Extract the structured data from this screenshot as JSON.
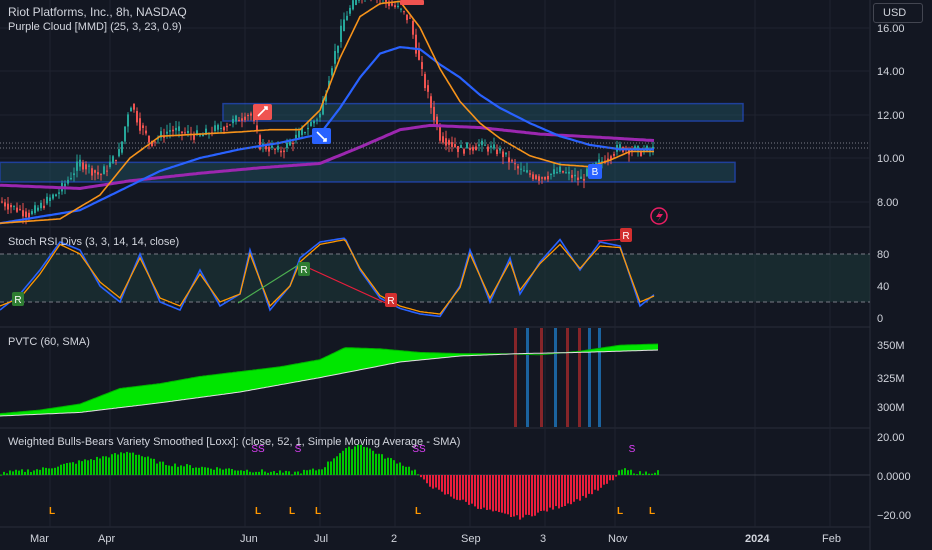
{
  "header": {
    "symbol_line": "Riot Platforms, Inc., 8h, NASDAQ",
    "indicator_line": "Purple Cloud [MMD] (25, 3, 23, 0.9)"
  },
  "currency_button": "USD",
  "panes": {
    "stoch_title": "Stoch RSI Divs (3, 3, 14, 14, close)",
    "pvtc_title": "PVTC  (60, SMA)",
    "loxx_title": "Weighted Bulls-Bears Variety Smoothed [Loxx]: (close, 52, 1, Simple Moving Average - SMA)"
  },
  "price_axis_labels": [
    "16.00",
    "14.00",
    "12.00",
    "10.00",
    "8.00"
  ],
  "stoch_axis_labels": [
    "80",
    "40",
    "0"
  ],
  "pvtc_axis_labels": [
    "350M",
    "325M",
    "300M"
  ],
  "loxx_axis_labels": [
    "20.00",
    "0.0000",
    "−20.00"
  ],
  "time_axis_labels": [
    "Mar",
    "Apr",
    "Jun",
    "Jul",
    "2",
    "Sep",
    "3",
    "Nov",
    "2024",
    "Feb"
  ],
  "markers": {
    "r_label": "R",
    "b_label": "B",
    "s_label": "S",
    "ss_label": "SS",
    "l_label": "L"
  },
  "colors": {
    "background": "#131722",
    "bull_candle": "#26a69a",
    "bear_candle": "#ef5350",
    "ma_blue": "#2962ff",
    "ma_orange": "#f7931a",
    "ma_purple": "#9c27b0",
    "stoch_k": "#2962ff",
    "stoch_d": "#ff9800",
    "pvtc_fill": "#00e600",
    "hist_pos": "#00c800",
    "hist_neg": "#e91e3c",
    "zone_border": "#2962ff"
  },
  "chart_data": [
    {
      "type": "candlestick",
      "title": "Riot Platforms, Inc., 8h, NASDAQ",
      "y_axis_labels": [
        "16.00",
        "14.00",
        "12.00",
        "10.00",
        "8.00"
      ],
      "x_axis_labels": [
        "Mar",
        "Apr",
        "Jun",
        "Jul",
        "2",
        "Sep",
        "3",
        "Nov",
        "2024",
        "Feb"
      ],
      "ylim": [
        7.0,
        17.0
      ],
      "close_path": [
        [
          0,
          8.0
        ],
        [
          30,
          7.4
        ],
        [
          60,
          8.5
        ],
        [
          80,
          9.8
        ],
        [
          100,
          9.2
        ],
        [
          120,
          10.3
        ],
        [
          130,
          12.6
        ],
        [
          140,
          11.5
        ],
        [
          150,
          10.7
        ],
        [
          170,
          11.3
        ],
        [
          200,
          11.0
        ],
        [
          230,
          11.6
        ],
        [
          250,
          12.1
        ],
        [
          260,
          10.6
        ],
        [
          280,
          10.3
        ],
        [
          300,
          11.1
        ],
        [
          320,
          12.0
        ],
        [
          330,
          14.0
        ],
        [
          345,
          16.5
        ],
        [
          360,
          17.5
        ],
        [
          375,
          17.5
        ],
        [
          400,
          16.8
        ],
        [
          410,
          16.3
        ],
        [
          420,
          14.2
        ],
        [
          430,
          12.5
        ],
        [
          440,
          11.0
        ],
        [
          460,
          10.4
        ],
        [
          480,
          10.6
        ],
        [
          500,
          10.3
        ],
        [
          520,
          9.4
        ],
        [
          540,
          9.1
        ],
        [
          560,
          9.4
        ],
        [
          580,
          9.0
        ],
        [
          600,
          9.8
        ],
        [
          620,
          10.5
        ],
        [
          640,
          10.3
        ],
        [
          655,
          10.4
        ]
      ],
      "ma_orange": [
        [
          0,
          7.0
        ],
        [
          60,
          7.2
        ],
        [
          100,
          8.3
        ],
        [
          130,
          10.0
        ],
        [
          160,
          11.0
        ],
        [
          200,
          11.1
        ],
        [
          240,
          11.2
        ],
        [
          270,
          11.3
        ],
        [
          300,
          11.3
        ],
        [
          320,
          12.2
        ],
        [
          340,
          14.6
        ],
        [
          360,
          16.5
        ],
        [
          380,
          17.1
        ],
        [
          400,
          17.2
        ],
        [
          420,
          16.0
        ],
        [
          440,
          14.1
        ],
        [
          460,
          12.6
        ],
        [
          480,
          11.6
        ],
        [
          500,
          10.9
        ],
        [
          530,
          10.1
        ],
        [
          560,
          9.7
        ],
        [
          590,
          9.6
        ],
        [
          610,
          9.9
        ],
        [
          630,
          10.3
        ],
        [
          655,
          10.3
        ]
      ],
      "ma_blue": [
        [
          0,
          7.0
        ],
        [
          80,
          7.6
        ],
        [
          120,
          8.5
        ],
        [
          160,
          9.4
        ],
        [
          200,
          10.0
        ],
        [
          240,
          10.4
        ],
        [
          280,
          10.7
        ],
        [
          320,
          11.1
        ],
        [
          340,
          12.3
        ],
        [
          360,
          13.7
        ],
        [
          380,
          14.8
        ],
        [
          400,
          15.1
        ],
        [
          420,
          15.0
        ],
        [
          440,
          14.3
        ],
        [
          460,
          13.7
        ],
        [
          480,
          12.9
        ],
        [
          500,
          12.3
        ],
        [
          530,
          11.6
        ],
        [
          560,
          11.0
        ],
        [
          590,
          10.6
        ],
        [
          620,
          10.4
        ],
        [
          655,
          10.4
        ]
      ],
      "ma_purple": [
        [
          0,
          8.75
        ],
        [
          80,
          8.6
        ],
        [
          130,
          8.95
        ],
        [
          200,
          9.3
        ],
        [
          260,
          9.55
        ],
        [
          320,
          9.75
        ],
        [
          360,
          10.5
        ],
        [
          400,
          11.3
        ],
        [
          430,
          11.5
        ],
        [
          480,
          11.4
        ],
        [
          540,
          11.1
        ],
        [
          600,
          10.95
        ],
        [
          655,
          10.8
        ]
      ],
      "zones": [
        {
          "low": 11.7,
          "high": 12.5
        },
        {
          "low": 8.9,
          "high": 9.8
        }
      ]
    },
    {
      "type": "line",
      "title": "Stoch RSI Divs (3, 3, 14, 14, close)",
      "y_axis_labels": [
        "80",
        "40",
        "0"
      ],
      "ylim": [
        0,
        100
      ],
      "bands": [
        20,
        80
      ],
      "series": [
        {
          "name": "K",
          "values": [
            [
              0,
              10
            ],
            [
              20,
              30
            ],
            [
              40,
              60
            ],
            [
              60,
              95
            ],
            [
              80,
              85
            ],
            [
              100,
              40
            ],
            [
              120,
              20
            ],
            [
              140,
              80
            ],
            [
              160,
              20
            ],
            [
              180,
              10
            ],
            [
              200,
              60
            ],
            [
              220,
              15
            ],
            [
              240,
              30
            ],
            [
              250,
              85
            ],
            [
              270,
              10
            ],
            [
              290,
              40
            ],
            [
              300,
              75
            ],
            [
              320,
              95
            ],
            [
              345,
              100
            ],
            [
              360,
              60
            ],
            [
              380,
              25
            ],
            [
              400,
              12
            ],
            [
              420,
              5
            ],
            [
              440,
              2
            ],
            [
              460,
              40
            ],
            [
              470,
              85
            ],
            [
              490,
              20
            ],
            [
              510,
              75
            ],
            [
              520,
              30
            ],
            [
              540,
              70
            ],
            [
              560,
              98
            ],
            [
              580,
              60
            ],
            [
              600,
              95
            ],
            [
              620,
              90
            ],
            [
              640,
              15
            ],
            [
              655,
              30
            ]
          ]
        },
        {
          "name": "D",
          "values": [
            [
              0,
              15
            ],
            [
              20,
              25
            ],
            [
              40,
              55
            ],
            [
              60,
              92
            ],
            [
              80,
              80
            ],
            [
              100,
              45
            ],
            [
              120,
              25
            ],
            [
              140,
              75
            ],
            [
              160,
              25
            ],
            [
              180,
              15
            ],
            [
              200,
              55
            ],
            [
              220,
              20
            ],
            [
              240,
              30
            ],
            [
              250,
              80
            ],
            [
              270,
              15
            ],
            [
              290,
              40
            ],
            [
              300,
              70
            ],
            [
              320,
              92
            ],
            [
              345,
              98
            ],
            [
              360,
              62
            ],
            [
              380,
              28
            ],
            [
              400,
              15
            ],
            [
              420,
              8
            ],
            [
              440,
              5
            ],
            [
              460,
              38
            ],
            [
              470,
              80
            ],
            [
              490,
              25
            ],
            [
              510,
              70
            ],
            [
              520,
              35
            ],
            [
              540,
              68
            ],
            [
              560,
              92
            ],
            [
              580,
              62
            ],
            [
              600,
              90
            ],
            [
              620,
              88
            ],
            [
              640,
              20
            ],
            [
              655,
              28
            ]
          ]
        }
      ]
    },
    {
      "type": "area",
      "title": "PVTC  (60, SMA)",
      "y_axis_labels": [
        "350M",
        "325M",
        "300M"
      ],
      "ylim": [
        290,
        360
      ],
      "series": [
        {
          "name": "PVT",
          "values": [
            [
              0,
              297
            ],
            [
              40,
              300
            ],
            [
              80,
              305
            ],
            [
              120,
              318
            ],
            [
              160,
              322
            ],
            [
              200,
              328
            ],
            [
              240,
              332
            ],
            [
              280,
              336
            ],
            [
              320,
              342
            ],
            [
              345,
              352
            ],
            [
              380,
              351
            ],
            [
              420,
              348
            ],
            [
              460,
              347
            ],
            [
              500,
              347
            ],
            [
              540,
              346
            ],
            [
              580,
              349
            ],
            [
              620,
              354
            ],
            [
              658,
              355
            ]
          ]
        },
        {
          "name": "SMA",
          "values": [
            [
              0,
              295
            ],
            [
              80,
              298
            ],
            [
              160,
              306
            ],
            [
              240,
              315
            ],
            [
              320,
              327
            ],
            [
              400,
              340
            ],
            [
              460,
              345
            ],
            [
              520,
              347
            ],
            [
              580,
              348
            ],
            [
              658,
              350
            ]
          ]
        }
      ]
    },
    {
      "type": "bar",
      "title": "Weighted Bulls-Bears Variety Smoothed [Loxx]: (close, 52, 1, Simple Moving Average - SMA)",
      "y_axis_labels": [
        "20.00",
        "0.0000",
        "−20.00"
      ],
      "ylim": [
        -24,
        24
      ],
      "series": [
        {
          "name": "Histogram",
          "values": [
            [
              0,
              1
            ],
            [
              40,
              3
            ],
            [
              70,
              6
            ],
            [
              100,
              9
            ],
            [
              130,
              12
            ],
            [
              160,
              6
            ],
            [
              200,
              4
            ],
            [
              230,
              3
            ],
            [
              260,
              2
            ],
            [
              290,
              1
            ],
            [
              320,
              3
            ],
            [
              340,
              12
            ],
            [
              360,
              16
            ],
            [
              380,
              10
            ],
            [
              400,
              6
            ],
            [
              415,
              2
            ],
            [
              420,
              -2
            ],
            [
              440,
              -9
            ],
            [
              460,
              -13
            ],
            [
              480,
              -17
            ],
            [
              500,
              -20
            ],
            [
              520,
              -22
            ],
            [
              540,
              -19
            ],
            [
              560,
              -16
            ],
            [
              580,
              -12
            ],
            [
              600,
              -7
            ],
            [
              615,
              -1
            ],
            [
              620,
              3
            ],
            [
              640,
              1
            ],
            [
              658,
              2
            ]
          ]
        }
      ]
    }
  ]
}
